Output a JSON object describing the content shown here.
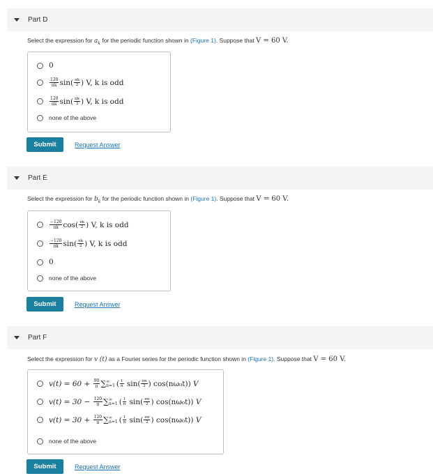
{
  "parts": [
    {
      "title": "Part D",
      "question_prefix": "Select the expression for",
      "question_var": "a",
      "question_sub": "k",
      "question_mid": "for the periodic function shown in",
      "figure_link": "(Figure 1)",
      "question_suffix": ". Suppose that",
      "given": "V = 60 V.",
      "choices": [
        {
          "label": "0"
        },
        {
          "coef_num": "120",
          "coef_den": "πk",
          "func": "sin",
          "arg_num": "πk",
          "arg_den": "2",
          "tail": "V, k is odd"
        },
        {
          "coef_num": "120",
          "coef_den": "πk",
          "func": "sin",
          "arg_num": "πk",
          "arg_den": "3",
          "tail": "V, k is odd"
        },
        {
          "label": "none of the above"
        }
      ],
      "submit": "Submit",
      "request": "Request Answer"
    },
    {
      "title": "Part E",
      "question_prefix": "Select the expression for",
      "question_var": "b",
      "question_sub": "k",
      "question_mid": "for the periodic function shown in",
      "figure_link": "(Figure 1)",
      "question_suffix": ". Suppose that",
      "given": "V = 60 V.",
      "choices": [
        {
          "coef_num": "−120",
          "coef_den": "πk",
          "func": "cos",
          "arg_num": "πk",
          "arg_den": "2",
          "tail": "V, k is odd"
        },
        {
          "coef_num": "−120",
          "coef_den": "πk",
          "func": "sin",
          "arg_num": "πk",
          "arg_den": "2",
          "tail": "V, k is odd"
        },
        {
          "label": "0"
        },
        {
          "label": "none of the above"
        }
      ],
      "submit": "Submit",
      "request": "Request Answer"
    },
    {
      "title": "Part F",
      "question_prefix": "Select the expression for",
      "question_var": "v (t)",
      "question_mid": "as a Fourier series for the periodic function shown in",
      "figure_link": "(Figure 1)",
      "question_suffix": ". Suppose that",
      "given": "V = 60 V.",
      "choices": [
        {
          "lhs": "v(t) = 60 +",
          "coef_num": "90",
          "coef_den": "π",
          "tail": "V"
        },
        {
          "lhs": "v(t) = 30 −",
          "coef_num": "120",
          "coef_den": "π",
          "tail": "V"
        },
        {
          "lhs": "v(t) = 30 +",
          "coef_num": "120",
          "coef_den": "π",
          "tail": "V"
        },
        {
          "label": "none of the above"
        }
      ],
      "series_body": "sin(",
      "series_cos": ") cos(nω₀t))",
      "submit": "Submit",
      "request": "Request Answer"
    }
  ]
}
